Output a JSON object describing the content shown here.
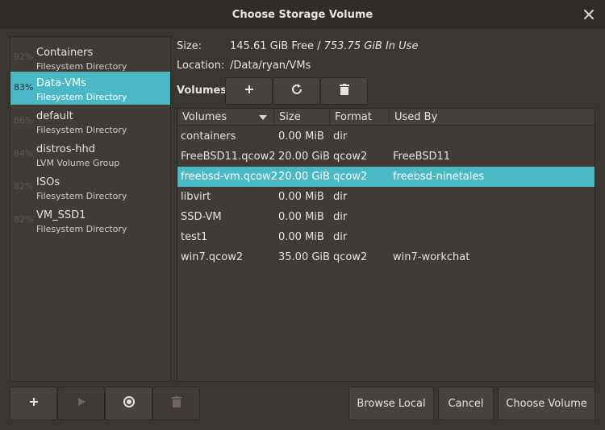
{
  "window": {
    "title": "Choose Storage Volume"
  },
  "pools": [
    {
      "percent": "92%",
      "name": "Containers",
      "type": "Filesystem Directory",
      "selected": false
    },
    {
      "percent": "83%",
      "name": "Data-VMs",
      "type": "Filesystem Directory",
      "selected": true
    },
    {
      "percent": "86%",
      "name": "default",
      "type": "Filesystem Directory",
      "selected": false
    },
    {
      "percent": "84%",
      "name": "distros-hhd",
      "type": "LVM Volume Group",
      "selected": false
    },
    {
      "percent": "82%",
      "name": "ISOs",
      "type": "Filesystem Directory",
      "selected": false
    },
    {
      "percent": "82%",
      "name": "VM_SSD1",
      "type": "Filesystem Directory",
      "selected": false
    }
  ],
  "details": {
    "size_label": "Size:",
    "size_free": "145.61 GiB Free",
    "size_sep": " / ",
    "size_in_use": "753.75 GiB In Use",
    "location_label": "Location:",
    "location_value": "/Data/ryan/VMs",
    "volumes_heading": "Volumes"
  },
  "volume_toolbar": {
    "add_icon": "plus-icon",
    "refresh_icon": "refresh-icon",
    "delete_icon": "trash-icon"
  },
  "table": {
    "columns": [
      "Volumes",
      "Size",
      "Format",
      "Used By"
    ],
    "rows": [
      {
        "name": "containers",
        "size": "0.00 MiB",
        "format": "dir",
        "used_by": "",
        "selected": false
      },
      {
        "name": "FreeBSD11.qcow2",
        "size": "20.00 GiB",
        "format": "qcow2",
        "used_by": "FreeBSD11",
        "selected": false
      },
      {
        "name": "freebsd-vm.qcow2",
        "size": "20.00 GiB",
        "format": "qcow2",
        "used_by": "freebsd-ninetales",
        "selected": true
      },
      {
        "name": "libvirt",
        "size": "0.00 MiB",
        "format": "dir",
        "used_by": "",
        "selected": false
      },
      {
        "name": "SSD-VM",
        "size": "0.00 MiB",
        "format": "dir",
        "used_by": "",
        "selected": false
      },
      {
        "name": "test1",
        "size": "0.00 MiB",
        "format": "dir",
        "used_by": "",
        "selected": false
      },
      {
        "name": "win7.qcow2",
        "size": "35.00 GiB",
        "format": "qcow2",
        "used_by": "win7-workchat",
        "selected": false
      }
    ]
  },
  "pool_toolbar": {
    "add_icon": "plus-icon",
    "start_icon": "play-icon",
    "stop_icon": "stop-record-icon",
    "delete_icon": "trash-icon"
  },
  "actions": {
    "browse_local": "Browse Local",
    "cancel": "Cancel",
    "choose_volume": "Choose Volume"
  },
  "colors": {
    "selection": "#4ab9c5",
    "background": "#3a3632",
    "titlebar": "#2f2c29"
  }
}
